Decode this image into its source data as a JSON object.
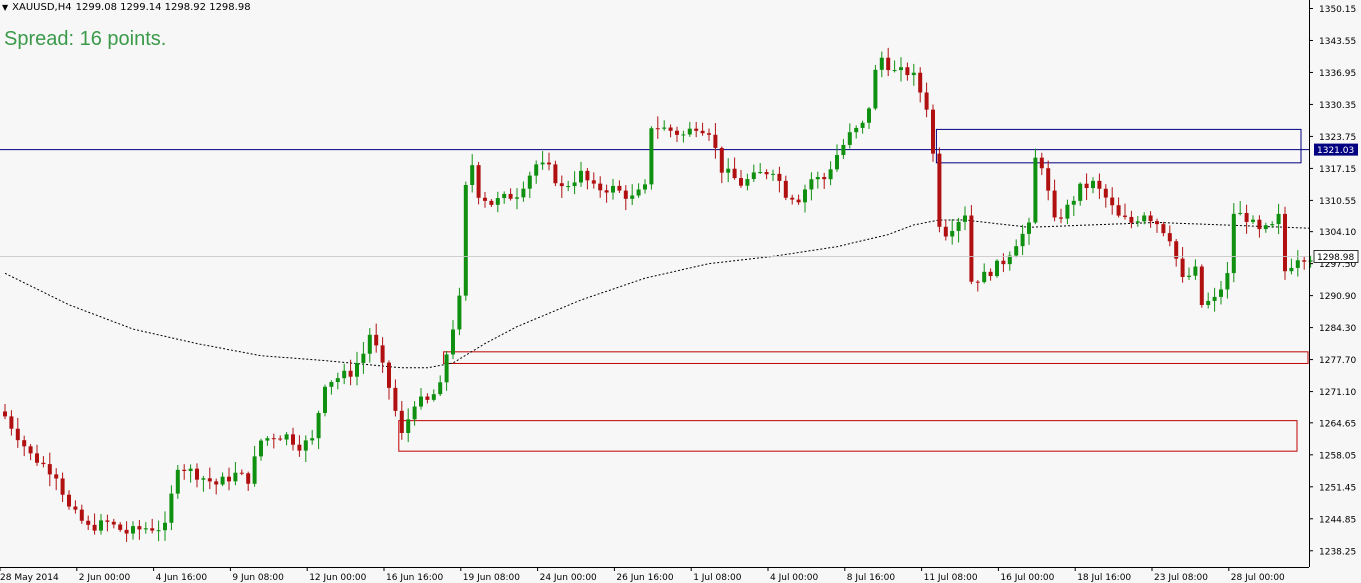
{
  "header": {
    "symbol": "XAUUSD,H4",
    "ohlc": "1299.08 1299.14 1298.92 1298.98",
    "dropdown_icon": "triangle-down-icon"
  },
  "spread": {
    "text": "Spread: 16 points."
  },
  "colors": {
    "background": "#f7f7f7",
    "bull": "#109010",
    "bear": "#b01010",
    "axis": "#000000",
    "hline": "#000080",
    "supply_zone": "#000080",
    "demand_zone": "#c00000",
    "ma": "#000000",
    "spread_text": "#3a9a4a",
    "price_label_bg": "#000080",
    "current_label_bg": "#ffffff"
  },
  "chart_data": {
    "type": "candlestick",
    "symbol": "XAUUSD",
    "timeframe": "H4",
    "ylim": [
      1234.9,
      1351.9
    ],
    "yticks": [
      "1350.15",
      "1343.55",
      "1336.95",
      "1330.35",
      "1323.75",
      "1317.15",
      "1310.55",
      "1304.10",
      "1297.50",
      "1290.90",
      "1284.30",
      "1277.70",
      "1271.10",
      "1264.65",
      "1258.05",
      "1251.45",
      "1244.85",
      "1238.25"
    ],
    "xticks": [
      {
        "label": "28 May 2014",
        "bar": 0
      },
      {
        "label": "2 Jun 00:00",
        "bar": 12
      },
      {
        "label": "4 Jun 16:00",
        "bar": 24
      },
      {
        "label": "9 Jun 08:00",
        "bar": 36
      },
      {
        "label": "12 Jun 00:00",
        "bar": 48
      },
      {
        "label": "16 Jun 16:00",
        "bar": 60
      },
      {
        "label": "19 Jun 08:00",
        "bar": 72
      },
      {
        "label": "24 Jun 00:00",
        "bar": 84
      },
      {
        "label": "26 Jun 16:00",
        "bar": 96
      },
      {
        "label": "1 Jul 08:00",
        "bar": 108
      },
      {
        "label": "4 Jul 00:00",
        "bar": 120
      },
      {
        "label": "8 Jul 16:00",
        "bar": 132
      },
      {
        "label": "11 Jul 08:00",
        "bar": 144
      },
      {
        "label": "16 Jul 00:00",
        "bar": 156
      },
      {
        "label": "18 Jul 16:00",
        "bar": 168
      },
      {
        "label": "23 Jul 08:00",
        "bar": 180
      },
      {
        "label": "28 Jul 00:00",
        "bar": 192
      }
    ],
    "close_anchors": [
      [
        0,
        1266
      ],
      [
        4,
        1258
      ],
      [
        8,
        1254
      ],
      [
        10,
        1247
      ],
      [
        13,
        1243
      ],
      [
        16,
        1244
      ],
      [
        19,
        1242
      ],
      [
        22,
        1243
      ],
      [
        25,
        1243
      ],
      [
        27,
        1256
      ],
      [
        30,
        1254
      ],
      [
        33,
        1252
      ],
      [
        36,
        1254
      ],
      [
        38,
        1253
      ],
      [
        40,
        1261
      ],
      [
        42,
        1262
      ],
      [
        44,
        1262
      ],
      [
        46,
        1260
      ],
      [
        48,
        1261
      ],
      [
        50,
        1273
      ],
      [
        52,
        1274
      ],
      [
        54,
        1275
      ],
      [
        56,
        1279
      ],
      [
        57,
        1283
      ],
      [
        58,
        1280
      ],
      [
        60,
        1272
      ],
      [
        62,
        1262
      ],
      [
        64,
        1269
      ],
      [
        66,
        1269
      ],
      [
        68,
        1272
      ],
      [
        69,
        1279
      ],
      [
        71,
        1290
      ],
      [
        72,
        1313
      ],
      [
        73,
        1318
      ],
      [
        74,
        1312
      ],
      [
        76,
        1310
      ],
      [
        80,
        1312
      ],
      [
        83,
        1318
      ],
      [
        85,
        1317
      ],
      [
        87,
        1313
      ],
      [
        90,
        1316
      ],
      [
        92,
        1313
      ],
      [
        95,
        1313
      ],
      [
        98,
        1311
      ],
      [
        100,
        1313
      ],
      [
        101,
        1326
      ],
      [
        104,
        1325
      ],
      [
        106,
        1324
      ],
      [
        108,
        1326
      ],
      [
        110,
        1325
      ],
      [
        112,
        1317
      ],
      [
        115,
        1314
      ],
      [
        118,
        1316
      ],
      [
        120,
        1317
      ],
      [
        122,
        1312
      ],
      [
        124,
        1311
      ],
      [
        126,
        1315
      ],
      [
        128,
        1315
      ],
      [
        130,
        1320
      ],
      [
        132,
        1324
      ],
      [
        134,
        1326
      ],
      [
        135,
        1330
      ],
      [
        136,
        1337
      ],
      [
        137,
        1340
      ],
      [
        139,
        1337
      ],
      [
        141,
        1337
      ],
      [
        142,
        1336
      ],
      [
        144,
        1330
      ],
      [
        145,
        1320
      ],
      [
        146,
        1306
      ],
      [
        147,
        1304
      ],
      [
        150,
        1308
      ],
      [
        151,
        1294
      ],
      [
        153,
        1295
      ],
      [
        156,
        1298
      ],
      [
        158,
        1302
      ],
      [
        160,
        1305
      ],
      [
        161,
        1319
      ],
      [
        162,
        1318
      ],
      [
        164,
        1306
      ],
      [
        166,
        1309
      ],
      [
        168,
        1313
      ],
      [
        170,
        1314
      ],
      [
        172,
        1311
      ],
      [
        174,
        1307
      ],
      [
        176,
        1306
      ],
      [
        178,
        1308
      ],
      [
        180,
        1306
      ],
      [
        182,
        1303
      ],
      [
        184,
        1294
      ],
      [
        186,
        1296
      ],
      [
        187,
        1289
      ],
      [
        189,
        1290
      ],
      [
        191,
        1295
      ],
      [
        192,
        1308
      ],
      [
        194,
        1307
      ],
      [
        196,
        1304
      ],
      [
        198,
        1305
      ],
      [
        199,
        1307
      ],
      [
        200,
        1296
      ],
      [
        202,
        1299
      ],
      [
        204,
        1299
      ]
    ],
    "ma_anchors": [
      [
        0,
        1295.5
      ],
      [
        10,
        1289
      ],
      [
        20,
        1284
      ],
      [
        30,
        1281
      ],
      [
        40,
        1278.5
      ],
      [
        50,
        1277.5
      ],
      [
        58,
        1276.5
      ],
      [
        62,
        1276
      ],
      [
        66,
        1276
      ],
      [
        70,
        1277
      ],
      [
        75,
        1281
      ],
      [
        80,
        1284.5
      ],
      [
        90,
        1290
      ],
      [
        100,
        1294.5
      ],
      [
        110,
        1297.5
      ],
      [
        120,
        1299
      ],
      [
        130,
        1301
      ],
      [
        138,
        1303.5
      ],
      [
        142,
        1305.5
      ],
      [
        146,
        1306.5
      ],
      [
        150,
        1306.5
      ],
      [
        160,
        1305
      ],
      [
        170,
        1305.5
      ],
      [
        180,
        1306
      ],
      [
        190,
        1305.5
      ],
      [
        200,
        1305
      ],
      [
        204,
        1304.8
      ]
    ],
    "horizontal_lines": [
      {
        "price": 1321.03,
        "label": "1321.03"
      }
    ],
    "current_price": {
      "price": 1298.98,
      "label": "1298.98"
    },
    "zones": [
      {
        "kind": "supply",
        "start_bar": 146,
        "top": 1325.2,
        "bottom": 1318.3
      },
      {
        "kind": "demand",
        "start_bar": 69,
        "top": 1279.3,
        "bottom": 1276.9
      },
      {
        "kind": "demand",
        "start_bar": 62,
        "top": 1265.1,
        "bottom": 1258.8
      }
    ]
  }
}
